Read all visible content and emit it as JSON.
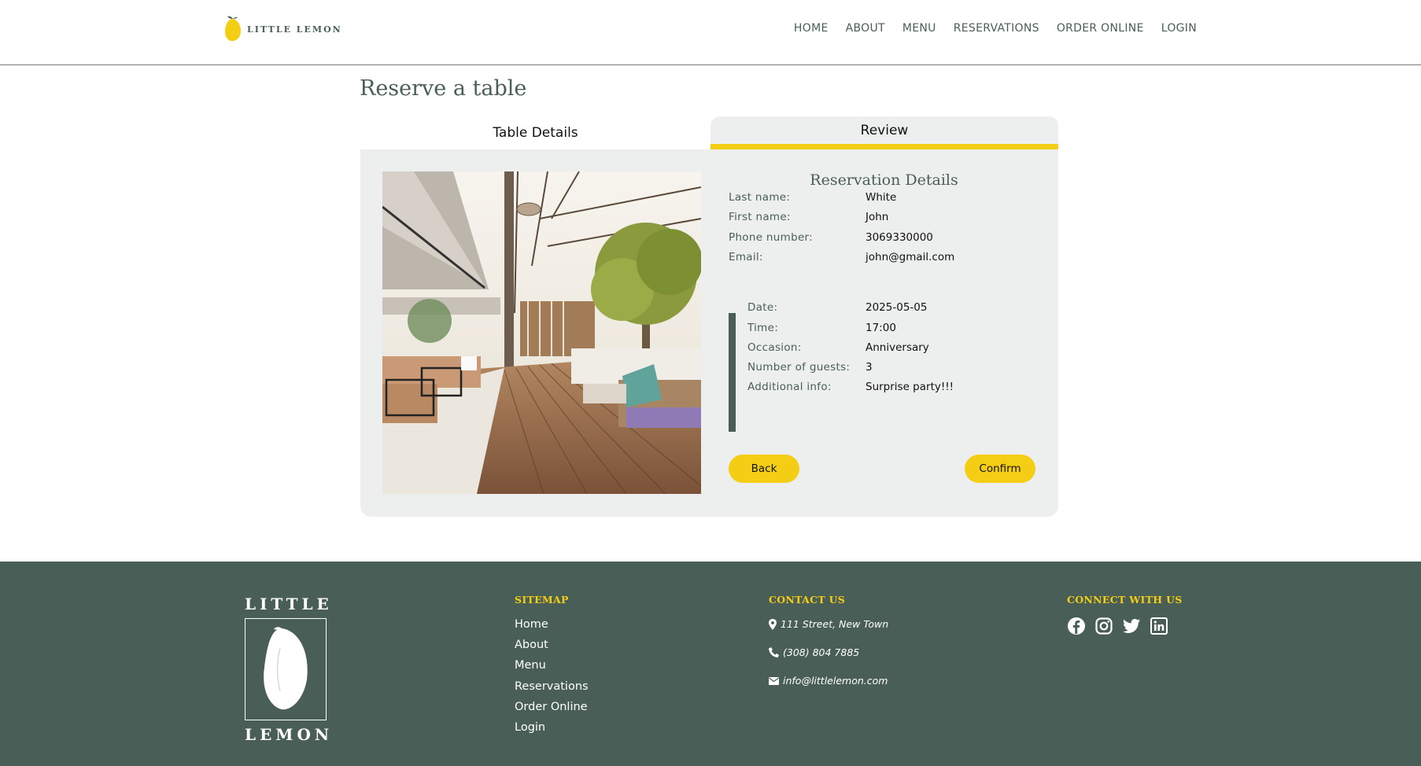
{
  "header": {
    "logo_text": "LITTLE LEMON",
    "nav": [
      "HOME",
      "ABOUT",
      "MENU",
      "RESERVATIONS",
      "ORDER ONLINE",
      "LOGIN"
    ]
  },
  "main": {
    "title": "Reserve a table",
    "tabs": [
      {
        "label": "Table Details",
        "active": false
      },
      {
        "label": "Review",
        "active": true
      }
    ],
    "review": {
      "title": "Reservation Details",
      "personal": [
        {
          "label": "Last name:",
          "value": "White"
        },
        {
          "label": "First name:",
          "value": "John"
        },
        {
          "label": "Phone number:",
          "value": "3069330000"
        },
        {
          "label": "Email:",
          "value": "john@gmail.com"
        }
      ],
      "details": [
        {
          "label": "Date:",
          "value": "2025-05-05"
        },
        {
          "label": "Time:",
          "value": "17:00"
        },
        {
          "label": "Occasion:",
          "value": "Anniversary"
        },
        {
          "label": "Number of guests:",
          "value": "3"
        },
        {
          "label": "Additional info:",
          "value": "Surprise party!!!"
        }
      ],
      "back_label": "Back",
      "confirm_label": "Confirm"
    }
  },
  "footer": {
    "logo_top": "LITTLE",
    "logo_bottom": "LEMON",
    "sitemap_title": "SITEMAP",
    "sitemap": [
      "Home",
      "About",
      "Menu",
      "Reservations",
      "Order Online",
      "Login"
    ],
    "contact_title": "CONTACT US",
    "contact": {
      "address": "111 Street, New Town",
      "phone": "(308) 804 7885",
      "email": "info@littlelemon.com"
    },
    "connect_title": "CONNECT WITH US",
    "social_icons": [
      "facebook-icon",
      "instagram-icon",
      "twitter-icon",
      "linkedin-icon"
    ]
  },
  "colors": {
    "primary_green": "#495e57",
    "primary_yellow": "#f4ce14",
    "panel_gray": "#edefee"
  }
}
